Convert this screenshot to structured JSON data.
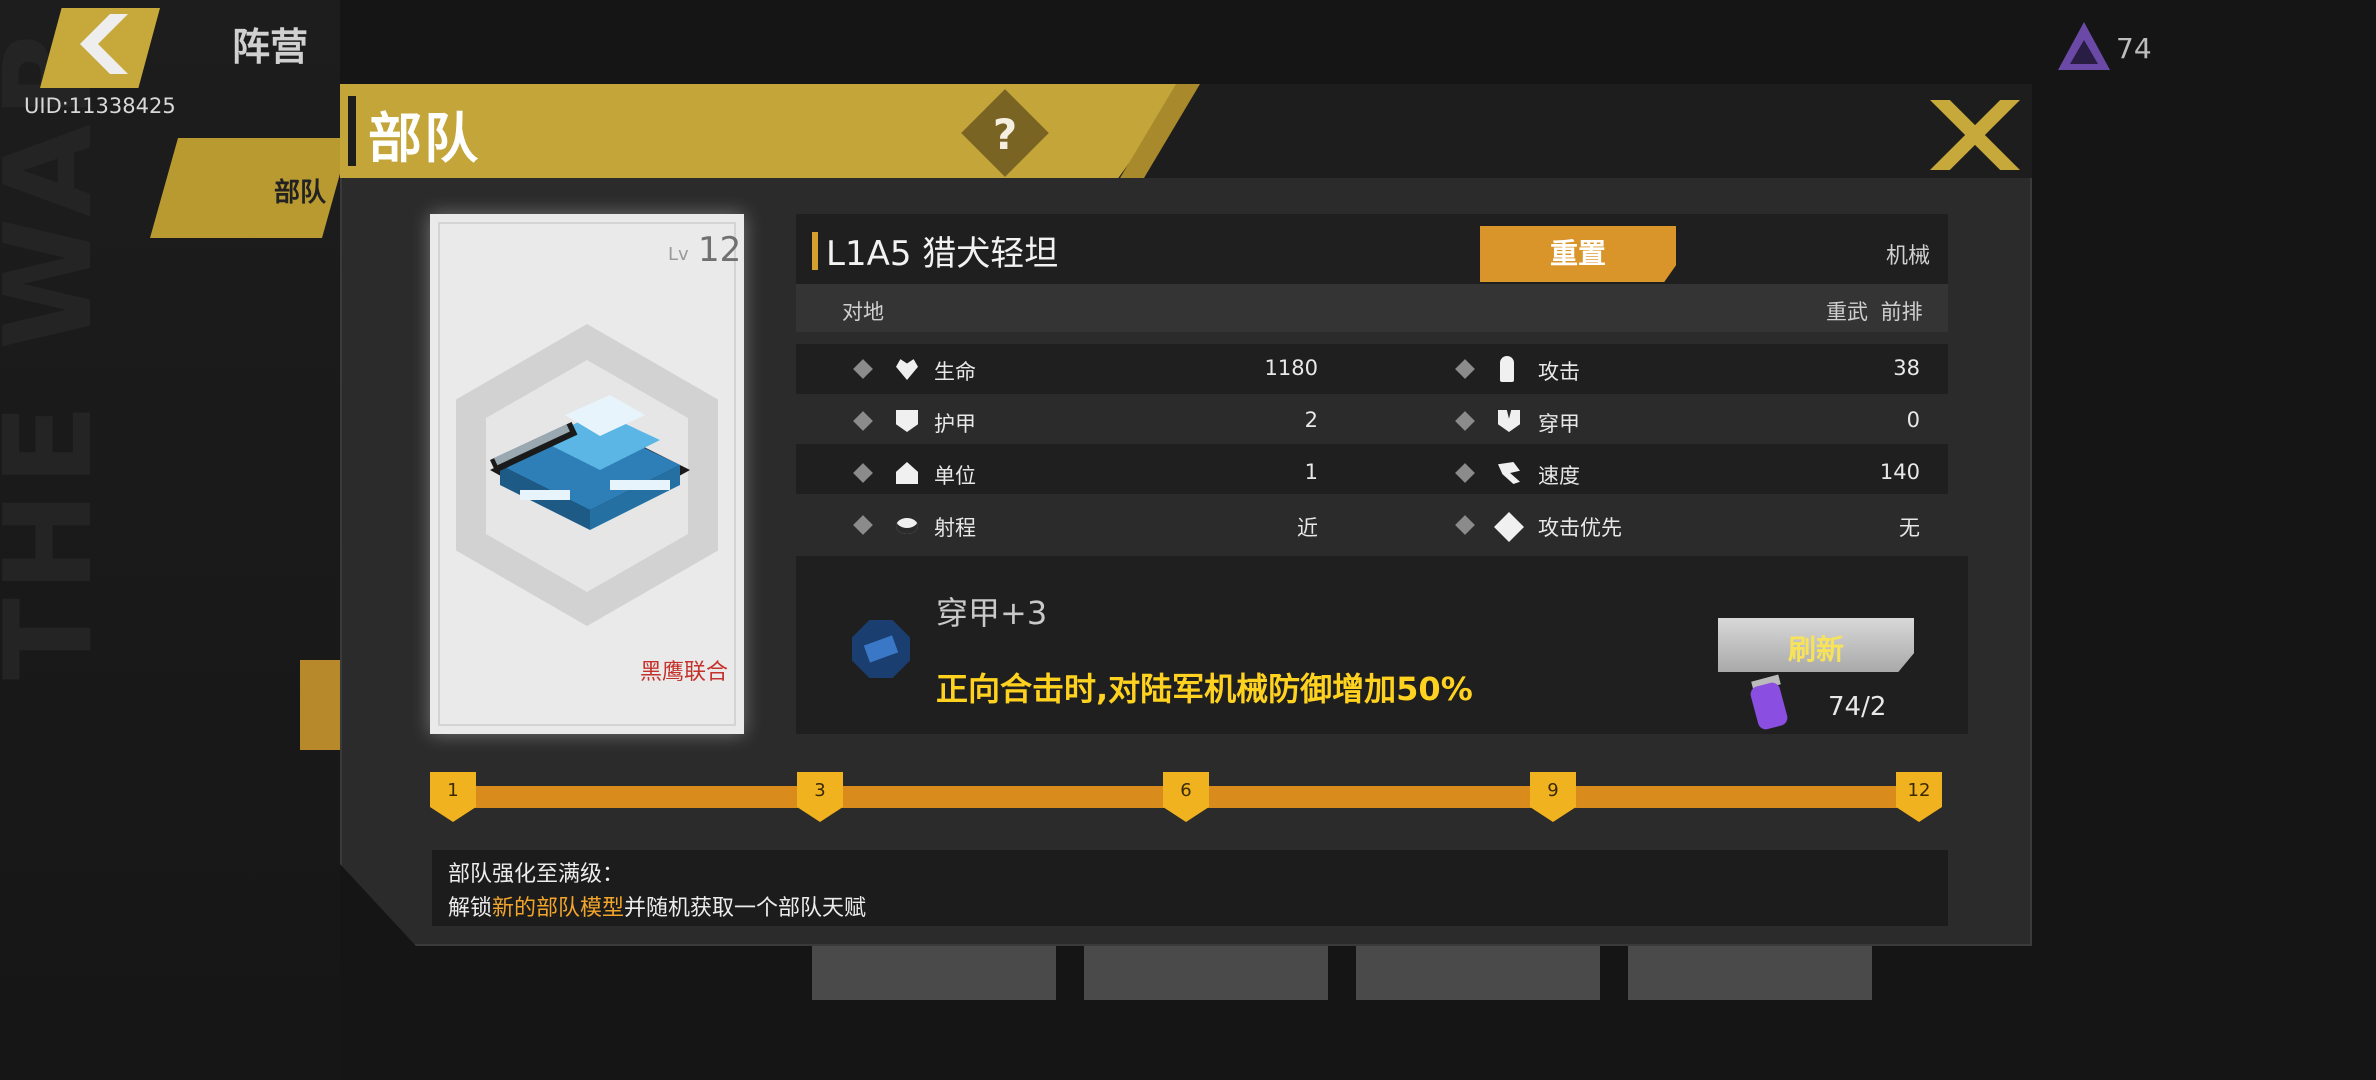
{
  "background": {
    "page_title": "阵营",
    "uid": "UID:11338425",
    "tab_label": "部队",
    "currency_count": "74"
  },
  "dialog": {
    "title": "部队",
    "help_label": "?",
    "unit": {
      "name": "L1A5 猎犬轻坦",
      "level_label": "Lv",
      "level": "12",
      "faction": "黑鹰联合",
      "type": "机械",
      "target": "对地",
      "class_tags": "重武 前排",
      "reset_label": "重置"
    },
    "stats": [
      {
        "label": "生命",
        "value": "1180",
        "icon": "heart-icon"
      },
      {
        "label": "攻击",
        "value": "38",
        "icon": "bullet-icon"
      },
      {
        "label": "护甲",
        "value": "2",
        "icon": "shield-icon"
      },
      {
        "label": "穿甲",
        "value": "0",
        "icon": "pierce-icon"
      },
      {
        "label": "单位",
        "value": "1",
        "icon": "unit-icon"
      },
      {
        "label": "速度",
        "value": "140",
        "icon": "speed-icon"
      },
      {
        "label": "射程",
        "value": "近",
        "icon": "range-icon"
      },
      {
        "label": "攻击优先",
        "value": "无",
        "icon": "priority-icon"
      }
    ],
    "talent": {
      "name": "穿甲+3",
      "description": "正向合击时,对陆军机械防御增加50%",
      "refresh_label": "刷新",
      "cost": "74/2"
    },
    "progress": {
      "milestones": [
        "1",
        "3",
        "6",
        "9",
        "12"
      ]
    },
    "max_upgrade": {
      "title": "部队强化至满级：",
      "prefix": "解锁",
      "highlight": "新的部队模型",
      "suffix": "并随机获取一个部队天赋"
    }
  },
  "colors": {
    "accent_gold": "#c4a53a",
    "button_orange": "#d9942a",
    "talent_yellow": "#ffd21f",
    "highlight_orange": "#f2a52a",
    "faction_red": "#c4322b"
  }
}
